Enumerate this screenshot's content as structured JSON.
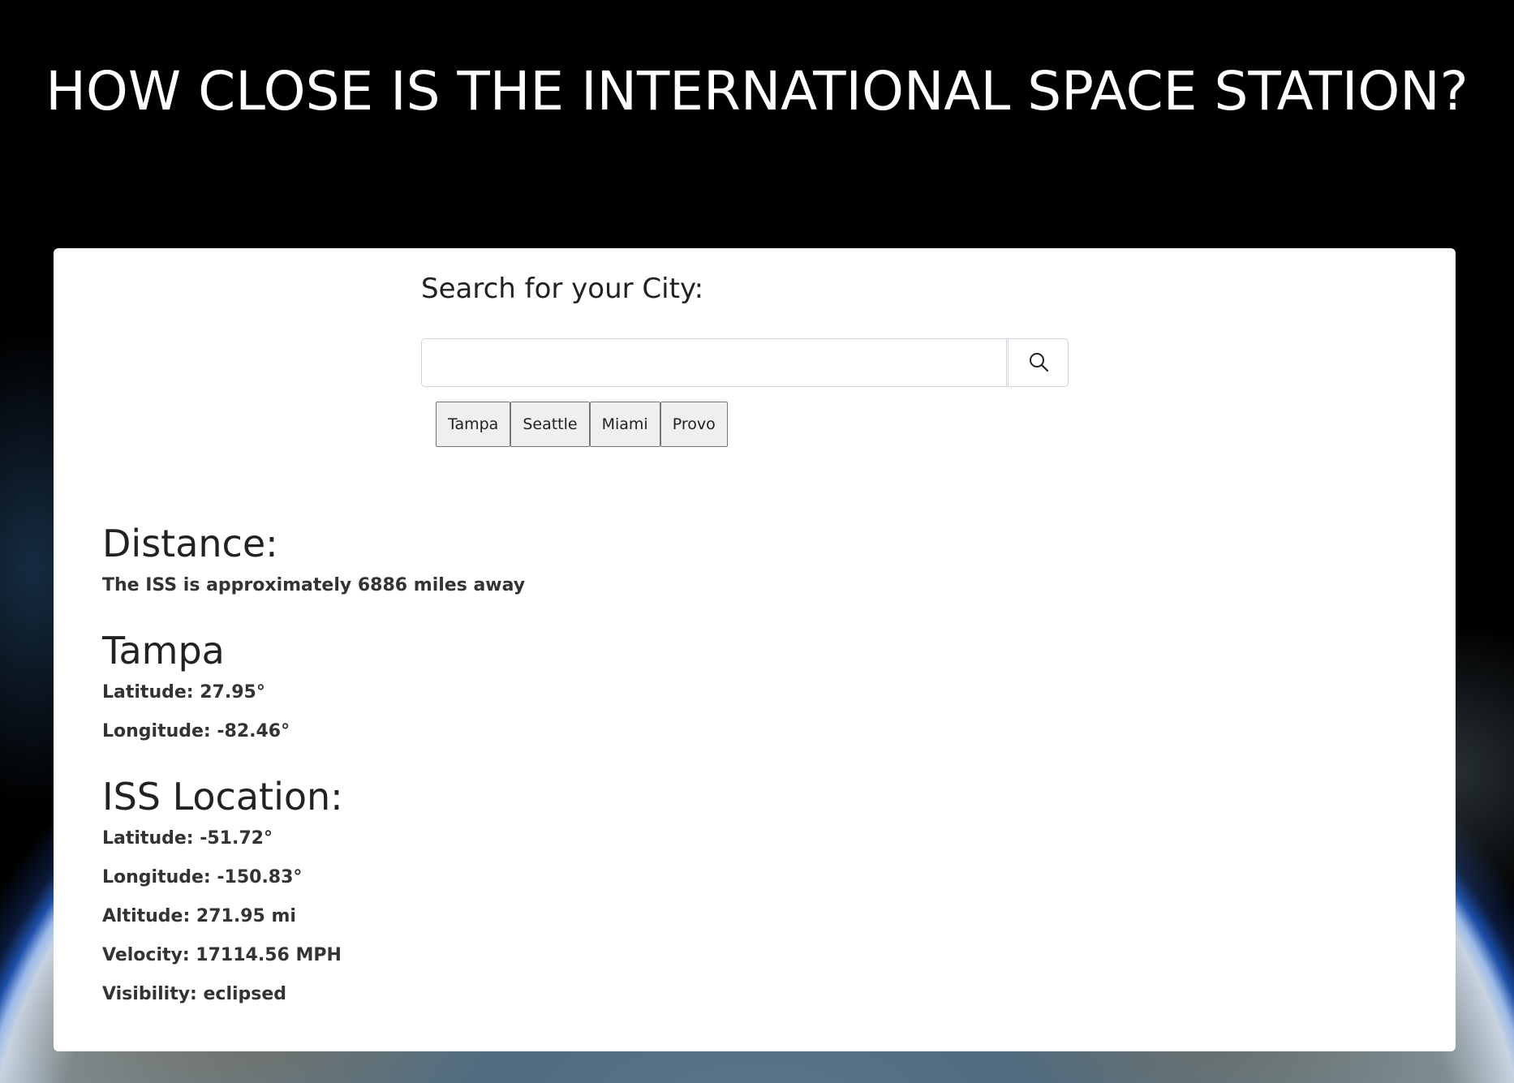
{
  "header": {
    "title": "HOW CLOSE IS THE INTERNATIONAL SPACE STATION?"
  },
  "search": {
    "label": "Search for your City:",
    "value": "",
    "placeholder": "",
    "button_icon": "search-icon"
  },
  "quick_cities": [
    {
      "label": "Tampa"
    },
    {
      "label": "Seattle"
    },
    {
      "label": "Miami"
    },
    {
      "label": "Provo"
    }
  ],
  "distance": {
    "heading": "Distance:",
    "text": "The ISS is approximately 6886 miles away"
  },
  "city": {
    "name": "Tampa",
    "latitude": "Latitude: 27.95°",
    "longitude": "Longitude: -82.46°"
  },
  "iss": {
    "heading": "ISS Location:",
    "latitude": "Latitude: -51.72°",
    "longitude": "Longitude: -150.83°",
    "altitude": "Altitude: 271.95 mi",
    "velocity": "Velocity: 17114.56 MPH",
    "visibility": "Visibility: eclipsed"
  }
}
